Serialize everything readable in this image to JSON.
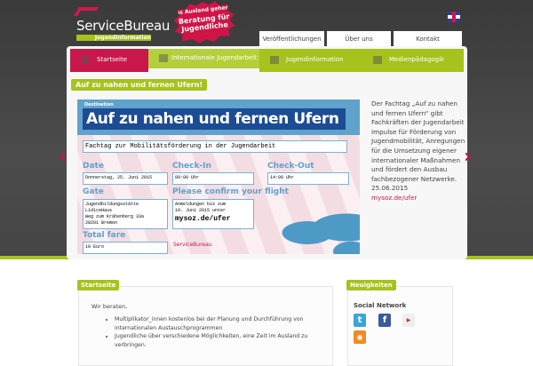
{
  "header": {
    "logo_name": "ServiceBureau",
    "logo_sub": "Jugendinformation",
    "badge_small": "Ins Ausland gehen?",
    "badge_big": "Beratung für Jugendliche",
    "language_icon": "uk-flag-icon"
  },
  "top_links": [
    "Veröffentlichungen",
    "Über uns",
    "Kontakt"
  ],
  "nav": [
    {
      "label": "Startseite",
      "icon": "home-icon"
    },
    {
      "label": "Internationale Jugendarbeit",
      "icon": "map-icon"
    },
    {
      "label": "Jugendinformation",
      "icon": "signpost-icon"
    },
    {
      "label": "Medienpädagogik",
      "icon": "tv-icon"
    }
  ],
  "feature": {
    "title": "Auf zu nahen und fernen Ufern!",
    "slide": {
      "destination": "Destination",
      "headline": "Auf zu nahen und fernen Ufern",
      "subtitle": "Fachtag zur Mobilitätsförderung in der Jugendarbeit",
      "date_label": "Date",
      "date": "Donnerstag, 25. Juni 2015",
      "checkin_label": "Check-In",
      "checkin": "09:00 Uhr",
      "checkout_label": "Check-Out",
      "checkout": "14:00 Uhr",
      "gate_label": "Gate",
      "gate": "Jugendbildungsstätte\nLidiceHaus\nWeg zum Krähenberg 33a\n28201 Bremen",
      "confirm_label": "Please confirm your flight",
      "confirm": "Anmeldungen bis zum\n19. Juni 2015 unter",
      "confirm_url": "mysoz.de/ufer",
      "fare_label": "Total fare",
      "fare": "10 Euro",
      "sponsor": "ServiceBureau"
    },
    "description": "Der Fachtag „Auf zu nahen und fernen Ufern“ gibt Fachkräften der Jugendarbeit Impulse für Förderung von Jugendmobilität, Anregungen für die Umsetzung eigener internationaler Maßnahmen und fördert den Ausbau fachbezogener Netzwerke.",
    "date": "25.06.2015",
    "link": "mysoz.de/ufer"
  },
  "startseite": {
    "heading": "Startseite",
    "intro": "Wir beraten,",
    "items": [
      "Multiplikator_innen kostenlos bei der Planung und Durchführung von internationalen Austauschprogrammen",
      "Jugendliche über verschiedene Möglichkeiten, eine Zeit im Ausland zu verbringen."
    ]
  },
  "news": {
    "heading": "Neuigkeiten",
    "social_title": "Social Network",
    "icons": [
      "twitter-icon",
      "facebook-icon",
      "youtube-icon",
      "rss-icon"
    ]
  },
  "colors": {
    "green": "#a6c21c",
    "pink": "#cf1448",
    "blue": "#1c4c94"
  }
}
